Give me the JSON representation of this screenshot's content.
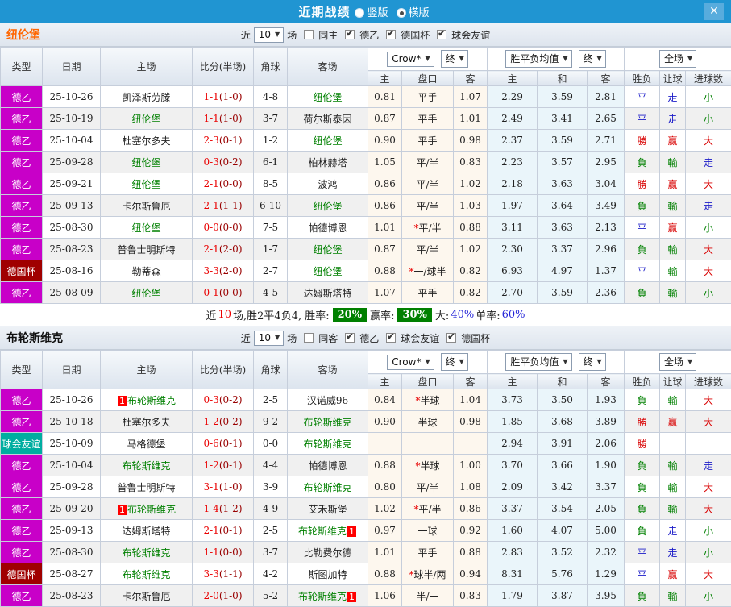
{
  "titlebar": {
    "title": "近期战绩",
    "radios": [
      {
        "label": "竖版",
        "selected": false
      },
      {
        "label": "横版",
        "selected": true
      }
    ],
    "close_icon": "✕"
  },
  "colors": {
    "titlebar_blue": "#2095d2",
    "league_de2_magenta": "#c800c8",
    "league_cup_darkred": "#a00000",
    "league_friendly_teal": "#00ada0",
    "team_highlight_green": "#008000",
    "win_red": "#d90000",
    "lose_green": "#008000",
    "draw_blue": "#1a1ac8",
    "team1_orange": "#ff6600",
    "summary_badge_green": "#008000"
  },
  "table_header": {
    "cols": [
      "类型",
      "日期",
      "主场",
      "比分(半场)",
      "角球",
      "客场"
    ],
    "dropdowns": {
      "company": "Crow*",
      "final1": "终",
      "avg": "胜平负均值",
      "final2": "终",
      "scope": "全场"
    },
    "subcols": [
      "主",
      "盘口",
      "客",
      "主",
      "和",
      "客",
      "胜负",
      "让球",
      "进球数"
    ]
  },
  "filter_common": {
    "near_label": "近",
    "matches_value": "10",
    "matches_suffix": "场"
  },
  "sections": [
    {
      "team": "纽伦堡",
      "team_color": "#ff6600",
      "filter": {
        "same_label": "同主",
        "same_checked": false,
        "leagues": [
          {
            "label": "德乙",
            "checked": true
          },
          {
            "label": "德国杯",
            "checked": true
          },
          {
            "label": "球会友谊",
            "checked": true
          }
        ]
      },
      "rows": [
        {
          "league": "德乙",
          "lg": "de2",
          "date": "25-10-26",
          "home": "凯泽斯劳滕",
          "home_hl": false,
          "home_badge": "",
          "score": "1-1",
          "half": "(1-0)",
          "corner": "4-8",
          "away": "纽伦堡",
          "away_hl": true,
          "away_badge": "",
          "o1": "0.81",
          "hc": "平手",
          "o2": "1.07",
          "a1": "2.29",
          "a2": "3.59",
          "a3": "2.81",
          "r1": "平",
          "r2": "走",
          "r3": "小"
        },
        {
          "league": "德乙",
          "lg": "de2",
          "date": "25-10-19",
          "home": "纽伦堡",
          "home_hl": true,
          "home_badge": "",
          "score": "1-1",
          "half": "(1-0)",
          "corner": "3-7",
          "away": "荷尔斯泰因",
          "away_hl": false,
          "away_badge": "",
          "o1": "0.87",
          "hc": "平手",
          "o2": "1.01",
          "a1": "2.49",
          "a2": "3.41",
          "a3": "2.65",
          "r1": "平",
          "r2": "走",
          "r3": "小"
        },
        {
          "league": "德乙",
          "lg": "de2",
          "date": "25-10-04",
          "home": "杜塞尔多夫",
          "home_hl": false,
          "home_badge": "",
          "score": "2-3",
          "half": "(0-1)",
          "corner": "1-2",
          "away": "纽伦堡",
          "away_hl": true,
          "away_badge": "",
          "o1": "0.90",
          "hc": "平手",
          "o2": "0.98",
          "a1": "2.37",
          "a2": "3.59",
          "a3": "2.71",
          "r1": "勝",
          "r2": "赢",
          "r3": "大"
        },
        {
          "league": "德乙",
          "lg": "de2",
          "date": "25-09-28",
          "home": "纽伦堡",
          "home_hl": true,
          "home_badge": "",
          "score": "0-3",
          "half": "(0-2)",
          "corner": "6-1",
          "away": "柏林赫塔",
          "away_hl": false,
          "away_badge": "",
          "o1": "1.05",
          "hc": "平/半",
          "o2": "0.83",
          "a1": "2.23",
          "a2": "3.57",
          "a3": "2.95",
          "r1": "負",
          "r2": "輸",
          "r3": "走"
        },
        {
          "league": "德乙",
          "lg": "de2",
          "date": "25-09-21",
          "home": "纽伦堡",
          "home_hl": true,
          "home_badge": "",
          "score": "2-1",
          "half": "(0-0)",
          "corner": "8-5",
          "away": "波鸿",
          "away_hl": false,
          "away_badge": "",
          "o1": "0.86",
          "hc": "平/半",
          "o2": "1.02",
          "a1": "2.18",
          "a2": "3.63",
          "a3": "3.04",
          "r1": "勝",
          "r2": "赢",
          "r3": "大"
        },
        {
          "league": "德乙",
          "lg": "de2",
          "date": "25-09-13",
          "home": "卡尔斯鲁厄",
          "home_hl": false,
          "home_badge": "",
          "score": "2-1",
          "half": "(1-1)",
          "corner": "6-10",
          "away": "纽伦堡",
          "away_hl": true,
          "away_badge": "",
          "o1": "0.86",
          "hc": "平/半",
          "o2": "1.03",
          "a1": "1.97",
          "a2": "3.64",
          "a3": "3.49",
          "r1": "負",
          "r2": "輸",
          "r3": "走"
        },
        {
          "league": "德乙",
          "lg": "de2",
          "date": "25-08-30",
          "home": "纽伦堡",
          "home_hl": true,
          "home_badge": "",
          "score": "0-0",
          "half": "(0-0)",
          "corner": "7-5",
          "away": "帕德博恩",
          "away_hl": false,
          "away_badge": "",
          "o1": "1.01",
          "hc": "*平/半",
          "o2": "0.88",
          "a1": "3.11",
          "a2": "3.63",
          "a3": "2.13",
          "r1": "平",
          "r2": "赢",
          "r3": "小"
        },
        {
          "league": "德乙",
          "lg": "de2",
          "date": "25-08-23",
          "home": "普鲁士明斯特",
          "home_hl": false,
          "home_badge": "",
          "score": "2-1",
          "half": "(2-0)",
          "corner": "1-7",
          "away": "纽伦堡",
          "away_hl": true,
          "away_badge": "",
          "o1": "0.87",
          "hc": "平/半",
          "o2": "1.02",
          "a1": "2.30",
          "a2": "3.37",
          "a3": "2.96",
          "r1": "負",
          "r2": "輸",
          "r3": "大"
        },
        {
          "league": "德国杯",
          "lg": "cup",
          "date": "25-08-16",
          "home": "勒蒂森",
          "home_hl": false,
          "home_badge": "",
          "score": "3-3",
          "half": "(2-0)",
          "corner": "2-7",
          "away": "纽伦堡",
          "away_hl": true,
          "away_badge": "",
          "o1": "0.88",
          "hc": "*一/球半",
          "o2": "0.82",
          "a1": "6.93",
          "a2": "4.97",
          "a3": "1.37",
          "r1": "平",
          "r2": "輸",
          "r3": "大"
        },
        {
          "league": "德乙",
          "lg": "de2",
          "date": "25-08-09",
          "home": "纽伦堡",
          "home_hl": true,
          "home_badge": "",
          "score": "0-1",
          "half": "(0-0)",
          "corner": "4-5",
          "away": "达姆斯塔特",
          "away_hl": false,
          "away_badge": "",
          "o1": "1.07",
          "hc": "平手",
          "o2": "0.82",
          "a1": "2.70",
          "a2": "3.59",
          "a3": "2.36",
          "r1": "負",
          "r2": "輸",
          "r3": "小"
        }
      ],
      "summary": [
        {
          "t": "近",
          "s": "k"
        },
        {
          "t": "10",
          "s": "red"
        },
        {
          "t": "场,胜2平4负4, 胜率:",
          "s": "k"
        },
        {
          "t": "20%",
          "s": "badge"
        },
        {
          "t": "赢率:",
          "s": "k"
        },
        {
          "t": "30%",
          "s": "badge"
        },
        {
          "t": "大:",
          "s": "k"
        },
        {
          "t": "40%",
          "s": "blue"
        },
        {
          "t": "单率:",
          "s": "k"
        },
        {
          "t": "60%",
          "s": "blue"
        }
      ]
    },
    {
      "team": "布轮斯维克",
      "team_color": "#111111",
      "filter": {
        "same_label": "同客",
        "same_checked": false,
        "leagues": [
          {
            "label": "德乙",
            "checked": true
          },
          {
            "label": "球会友谊",
            "checked": true
          },
          {
            "label": "德国杯",
            "checked": true
          }
        ]
      },
      "rows": [
        {
          "league": "德乙",
          "lg": "de2",
          "date": "25-10-26",
          "home": "布轮斯维克",
          "home_hl": true,
          "home_badge": "1",
          "score": "0-3",
          "half": "(0-2)",
          "corner": "2-5",
          "away": "汉诺威96",
          "away_hl": false,
          "away_badge": "",
          "o1": "0.84",
          "hc": "*半球",
          "o2": "1.04",
          "a1": "3.73",
          "a2": "3.50",
          "a3": "1.93",
          "r1": "負",
          "r2": "輸",
          "r3": "大"
        },
        {
          "league": "德乙",
          "lg": "de2",
          "date": "25-10-18",
          "home": "杜塞尔多夫",
          "home_hl": false,
          "home_badge": "",
          "score": "1-2",
          "half": "(0-2)",
          "corner": "9-2",
          "away": "布轮斯维克",
          "away_hl": true,
          "away_badge": "",
          "o1": "0.90",
          "hc": "半球",
          "o2": "0.98",
          "a1": "1.85",
          "a2": "3.68",
          "a3": "3.89",
          "r1": "勝",
          "r2": "赢",
          "r3": "大"
        },
        {
          "league": "球会友谊",
          "lg": "fr",
          "date": "25-10-09",
          "home": "马格德堡",
          "home_hl": false,
          "home_badge": "",
          "score": "0-6",
          "half": "(0-1)",
          "corner": "0-0",
          "away": "布轮斯维克",
          "away_hl": true,
          "away_badge": "",
          "o1": "",
          "hc": "",
          "o2": "",
          "a1": "2.94",
          "a2": "3.91",
          "a3": "2.06",
          "r1": "勝",
          "r2": "",
          "r3": ""
        },
        {
          "league": "德乙",
          "lg": "de2",
          "date": "25-10-04",
          "home": "布轮斯维克",
          "home_hl": true,
          "home_badge": "",
          "score": "1-2",
          "half": "(0-1)",
          "corner": "4-4",
          "away": "帕德博恩",
          "away_hl": false,
          "away_badge": "",
          "o1": "0.88",
          "hc": "*半球",
          "o2": "1.00",
          "a1": "3.70",
          "a2": "3.66",
          "a3": "1.90",
          "r1": "負",
          "r2": "輸",
          "r3": "走"
        },
        {
          "league": "德乙",
          "lg": "de2",
          "date": "25-09-28",
          "home": "普鲁士明斯特",
          "home_hl": false,
          "home_badge": "",
          "score": "3-1",
          "half": "(1-0)",
          "corner": "3-9",
          "away": "布轮斯维克",
          "away_hl": true,
          "away_badge": "",
          "o1": "0.80",
          "hc": "平/半",
          "o2": "1.08",
          "a1": "2.09",
          "a2": "3.42",
          "a3": "3.37",
          "r1": "負",
          "r2": "輸",
          "r3": "大"
        },
        {
          "league": "德乙",
          "lg": "de2",
          "date": "25-09-20",
          "home": "布轮斯维克",
          "home_hl": true,
          "home_badge": "1",
          "score": "1-4",
          "half": "(1-2)",
          "corner": "4-9",
          "away": "艾禾斯堡",
          "away_hl": false,
          "away_badge": "",
          "o1": "1.02",
          "hc": "*平/半",
          "o2": "0.86",
          "a1": "3.37",
          "a2": "3.54",
          "a3": "2.05",
          "r1": "負",
          "r2": "輸",
          "r3": "大"
        },
        {
          "league": "德乙",
          "lg": "de2",
          "date": "25-09-13",
          "home": "达姆斯塔特",
          "home_hl": false,
          "home_badge": "",
          "score": "2-1",
          "half": "(0-1)",
          "corner": "2-5",
          "away": "布轮斯维克",
          "away_hl": true,
          "away_badge": "1",
          "o1": "0.97",
          "hc": "一球",
          "o2": "0.92",
          "a1": "1.60",
          "a2": "4.07",
          "a3": "5.00",
          "r1": "負",
          "r2": "走",
          "r3": "小"
        },
        {
          "league": "德乙",
          "lg": "de2",
          "date": "25-08-30",
          "home": "布轮斯维克",
          "home_hl": true,
          "home_badge": "",
          "score": "1-1",
          "half": "(0-0)",
          "corner": "3-7",
          "away": "比勒费尔德",
          "away_hl": false,
          "away_badge": "",
          "o1": "1.01",
          "hc": "平手",
          "o2": "0.88",
          "a1": "2.83",
          "a2": "3.52",
          "a3": "2.32",
          "r1": "平",
          "r2": "走",
          "r3": "小"
        },
        {
          "league": "德国杯",
          "lg": "cup",
          "date": "25-08-27",
          "home": "布轮斯维克",
          "home_hl": true,
          "home_badge": "",
          "score": "3-3",
          "half": "(1-1)",
          "corner": "4-2",
          "away": "斯图加特",
          "away_hl": false,
          "away_badge": "",
          "o1": "0.88",
          "hc": "*球半/两",
          "o2": "0.94",
          "a1": "8.31",
          "a2": "5.76",
          "a3": "1.29",
          "r1": "平",
          "r2": "赢",
          "r3": "大"
        },
        {
          "league": "德乙",
          "lg": "de2",
          "date": "25-08-23",
          "home": "卡尔斯鲁厄",
          "home_hl": false,
          "home_badge": "",
          "score": "2-0",
          "half": "(1-0)",
          "corner": "5-2",
          "away": "布轮斯维克",
          "away_hl": true,
          "away_badge": "1",
          "o1": "1.06",
          "hc": "半/一",
          "o2": "0.83",
          "a1": "1.79",
          "a2": "3.87",
          "a3": "3.95",
          "r1": "負",
          "r2": "輸",
          "r3": "小"
        }
      ],
      "summary": null
    }
  ]
}
